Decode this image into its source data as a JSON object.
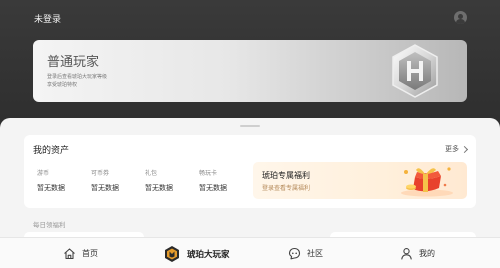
{
  "header": {
    "login_status": "未登录",
    "avatar_icon": "user-avatar-icon"
  },
  "member_card": {
    "title": "普通玩家",
    "subtitle_line1": "登录后查看琥珀大玩家等级",
    "subtitle_line2": "享受琥珀特权",
    "badge_icon": "hexagon-h-badge-icon"
  },
  "assets": {
    "title": "我的资产",
    "more_label": "更多",
    "items": [
      {
        "label": "游币",
        "value": "暂无数据"
      },
      {
        "label": "可币券",
        "value": "暂无数据"
      },
      {
        "label": "礼包",
        "value": "暂无数据"
      },
      {
        "label": "畅玩卡",
        "value": "暂无数据"
      }
    ],
    "promo": {
      "title": "琥珀专属福利",
      "subtitle": "登录查看专属福利",
      "icon": "gift-box-icon"
    }
  },
  "daily": {
    "label": "每日领福利"
  },
  "tabbar": {
    "items": [
      {
        "label": "首页",
        "icon": "home-icon"
      },
      {
        "label": "琥珀大玩家",
        "icon": "amber-player-logo-icon",
        "active": true
      },
      {
        "label": "社区",
        "icon": "community-icon"
      },
      {
        "label": "我的",
        "icon": "profile-icon"
      }
    ]
  },
  "colors": {
    "header_bg": "#333333",
    "promo_bg": "#fff3e2",
    "promo_accent": "#e8412c",
    "brand_logo": "#e39a2a"
  }
}
